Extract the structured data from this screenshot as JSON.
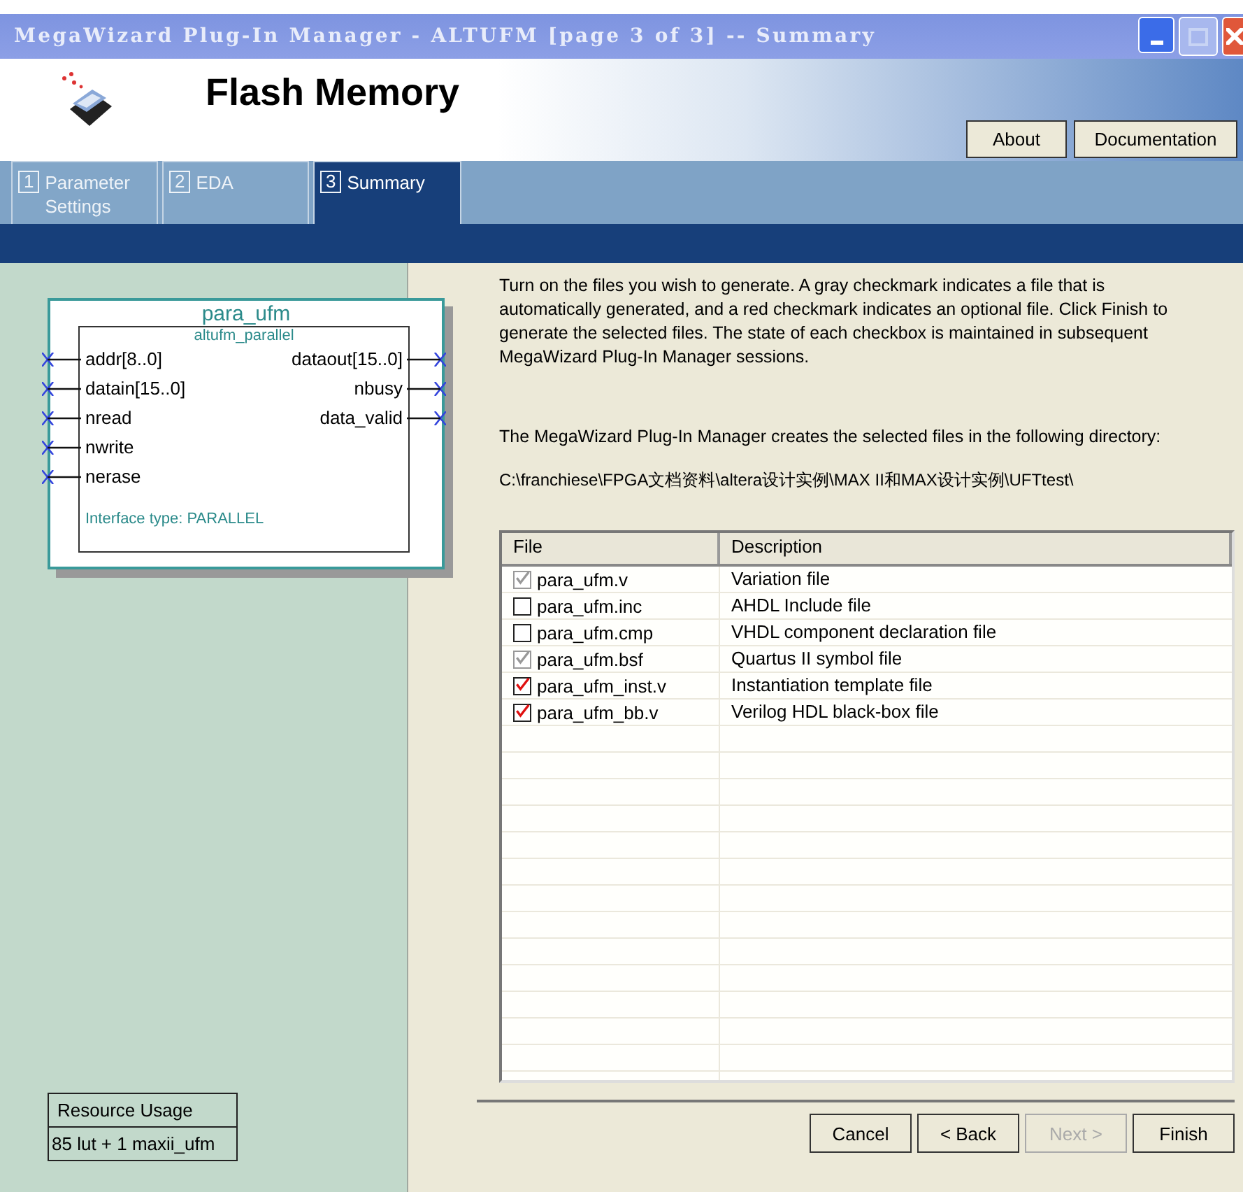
{
  "window": {
    "title": "MegaWizard Plug-In Manager - ALTUFM [page 3 of 3] -- Summary"
  },
  "header": {
    "title": "Flash Memory",
    "buttons": [
      "About",
      "Documentation"
    ]
  },
  "tabs": [
    {
      "number": "1",
      "label": "Parameter Settings",
      "selected": false
    },
    {
      "number": "2",
      "label": "EDA",
      "selected": false
    },
    {
      "number": "3",
      "label": "Summary",
      "selected": true
    }
  ],
  "symbol": {
    "name": "para_ufm",
    "subtitle": "altufm_parallel",
    "inputs": [
      "addr[8..0]",
      "datain[15..0]",
      "nread",
      "nwrite",
      "nerase"
    ],
    "outputs": [
      "dataout[15..0]",
      "nbusy",
      "data_valid"
    ],
    "note": "Interface type: PARALLEL"
  },
  "resource_usage": {
    "heading": "Resource Usage",
    "value": "85 lut + 1 maxii_ufm"
  },
  "instructions": "Turn on the files you wish to generate. A gray checkmark indicates a file that is automatically generated, and a red checkmark indicates an optional file. Click Finish to generate the selected files. The state of each checkbox is maintained in subsequent MegaWizard Plug-In Manager sessions.",
  "directory_label": "The MegaWizard Plug-In Manager creates the selected files in the following directory:",
  "directory": "C:\\franchiese\\FPGA文档资料\\altera设计实例\\MAX II和MAX设计实例\\UFTtest\\",
  "table": {
    "columns": [
      "File",
      "Description"
    ],
    "rows": [
      {
        "file": "para_ufm.v",
        "description": "Variation file",
        "checked": true,
        "kind": "automatic"
      },
      {
        "file": "para_ufm.inc",
        "description": "AHDL Include file",
        "checked": false,
        "kind": "optional"
      },
      {
        "file": "para_ufm.cmp",
        "description": "VHDL component declaration file",
        "checked": false,
        "kind": "optional"
      },
      {
        "file": "para_ufm.bsf",
        "description": "Quartus II symbol file",
        "checked": true,
        "kind": "automatic"
      },
      {
        "file": "para_ufm_inst.v",
        "description": "Instantiation template file",
        "checked": true,
        "kind": "optional"
      },
      {
        "file": "para_ufm_bb.v",
        "description": "Verilog HDL black-box file",
        "checked": true,
        "kind": "optional"
      }
    ]
  },
  "buttons": [
    {
      "label": "Cancel",
      "disabled": false
    },
    {
      "label": "< Back",
      "disabled": false
    },
    {
      "label": "Next >",
      "disabled": true
    },
    {
      "label": "Finish",
      "disabled": false
    }
  ]
}
